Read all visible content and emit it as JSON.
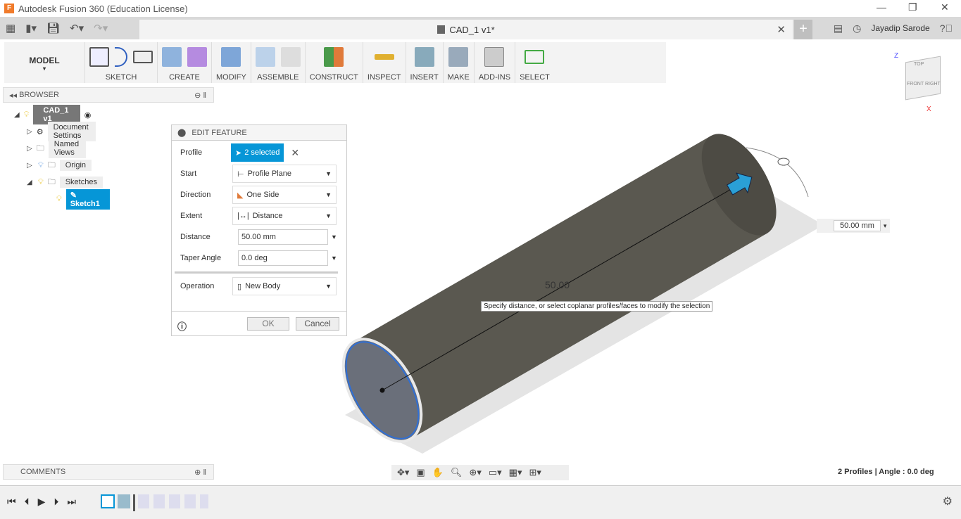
{
  "window": {
    "title": "Autodesk Fusion 360 (Education License)",
    "doc_tab": "CAD_1 v1*",
    "user": "Jayadip Sarode"
  },
  "toolbar": {
    "workspace": "MODEL",
    "groups": [
      "SKETCH",
      "CREATE",
      "MODIFY",
      "ASSEMBLE",
      "CONSTRUCT",
      "INSPECT",
      "INSERT",
      "MAKE",
      "ADD-INS",
      "SELECT"
    ]
  },
  "browser": {
    "title": "BROWSER",
    "items": [
      {
        "label": "CAD_1 v1"
      },
      {
        "label": "Document Settings"
      },
      {
        "label": "Named Views"
      },
      {
        "label": "Origin"
      },
      {
        "label": "Sketches"
      },
      {
        "label": "Sketch1"
      }
    ]
  },
  "dialog": {
    "title": "EDIT FEATURE",
    "profile_label": "Profile",
    "profile_value": "2 selected",
    "start_label": "Start",
    "start_value": "Profile Plane",
    "direction_label": "Direction",
    "direction_value": "One Side",
    "extent_label": "Extent",
    "extent_value": "Distance",
    "distance_label": "Distance",
    "distance_value": "50.00 mm",
    "taper_label": "Taper Angle",
    "taper_value": "0.0 deg",
    "operation_label": "Operation",
    "operation_value": "New Body",
    "ok": "OK",
    "cancel": "Cancel"
  },
  "viewport": {
    "dimension_label": "50.00",
    "distance_box": "50.00 mm",
    "tooltip": "Specify distance, or select coplanar profiles/faces to modify the selection",
    "viewcube": {
      "top": "TOP",
      "front": "FRONT",
      "right": "RIGHT",
      "z": "Z",
      "x": "X"
    }
  },
  "comments": {
    "title": "COMMENTS"
  },
  "status": "2 Profiles | Angle : 0.0 deg",
  "colors": {
    "accent": "#0696d7",
    "body": "#5a5850",
    "selection": "#2f6fd6"
  }
}
